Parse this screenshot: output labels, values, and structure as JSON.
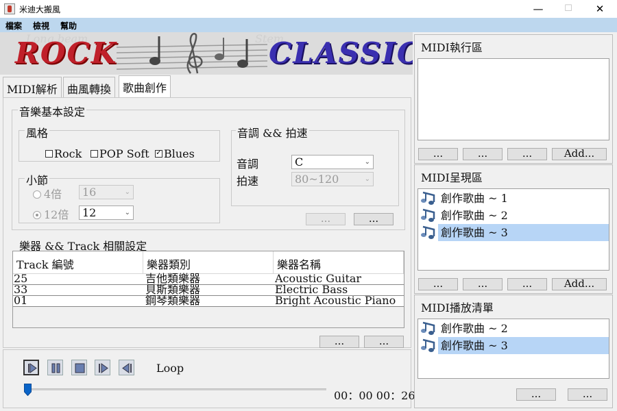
{
  "window": {
    "title": "米迪大搬風",
    "minimize": "—",
    "maximize": "☐",
    "close": "✕"
  },
  "menu": [
    "檔案",
    "檢視",
    "幫助"
  ],
  "banner": {
    "left_word": "ROCK",
    "right_word": "CLASSIC",
    "bg_words": [
      "Long beam",
      "Stem",
      "Black"
    ]
  },
  "tabs": [
    {
      "label": "MIDI解析",
      "active": false
    },
    {
      "label": "曲風轉換",
      "active": false
    },
    {
      "label": "歌曲創作",
      "active": true
    }
  ],
  "music_settings": {
    "title": "音樂基本設定",
    "style": {
      "title": "風格",
      "options": [
        {
          "label": "Rock",
          "checked": false
        },
        {
          "label": "POP Soft",
          "checked": false
        },
        {
          "label": "Blues",
          "checked": true
        }
      ]
    },
    "measure": {
      "title": "小節",
      "options": [
        {
          "label": "4倍",
          "value": "16",
          "selected": false
        },
        {
          "label": "12倍",
          "value": "12",
          "selected": true
        }
      ]
    },
    "key_tempo": {
      "title": "音調 && 拍速",
      "key_label": "音調",
      "key_value": "C",
      "tempo_label": "拍速",
      "tempo_value": "80~120"
    },
    "btn_a": "...",
    "btn_b": "..."
  },
  "instruments": {
    "title": "樂器 && Track 相關設定",
    "columns": [
      "Track 編號",
      "樂器類別",
      "樂器名稱"
    ],
    "rows": [
      [
        "25",
        "吉他類樂器",
        "Acoustic Guitar"
      ],
      [
        "33",
        "貝斯類樂器",
        "Electric Bass"
      ],
      [
        "01",
        "鋼琴類樂器",
        "Bright Acoustic Piano"
      ]
    ],
    "btn_a": "...",
    "btn_b": "..."
  },
  "player": {
    "loop_label": "Loop",
    "time": "00：00 00：26",
    "progress": 0.0
  },
  "midi_exec": {
    "title": "MIDI執行區",
    "buttons": [
      "...",
      "...",
      "...",
      "Add..."
    ]
  },
  "midi_display": {
    "title": "MIDI呈現區",
    "items": [
      {
        "label": "創作歌曲 ~ 1",
        "selected": false
      },
      {
        "label": "創作歌曲 ~ 2",
        "selected": false
      },
      {
        "label": "創作歌曲 ~ 3",
        "selected": true
      }
    ],
    "buttons": [
      "...",
      "...",
      "...",
      "Add..."
    ]
  },
  "midi_playlist": {
    "title": "MIDI播放清單",
    "items": [
      {
        "label": "創作歌曲 ~ 2",
        "selected": false
      },
      {
        "label": "創作歌曲 ~ 3",
        "selected": true
      }
    ],
    "buttons": [
      "...",
      "..."
    ]
  }
}
